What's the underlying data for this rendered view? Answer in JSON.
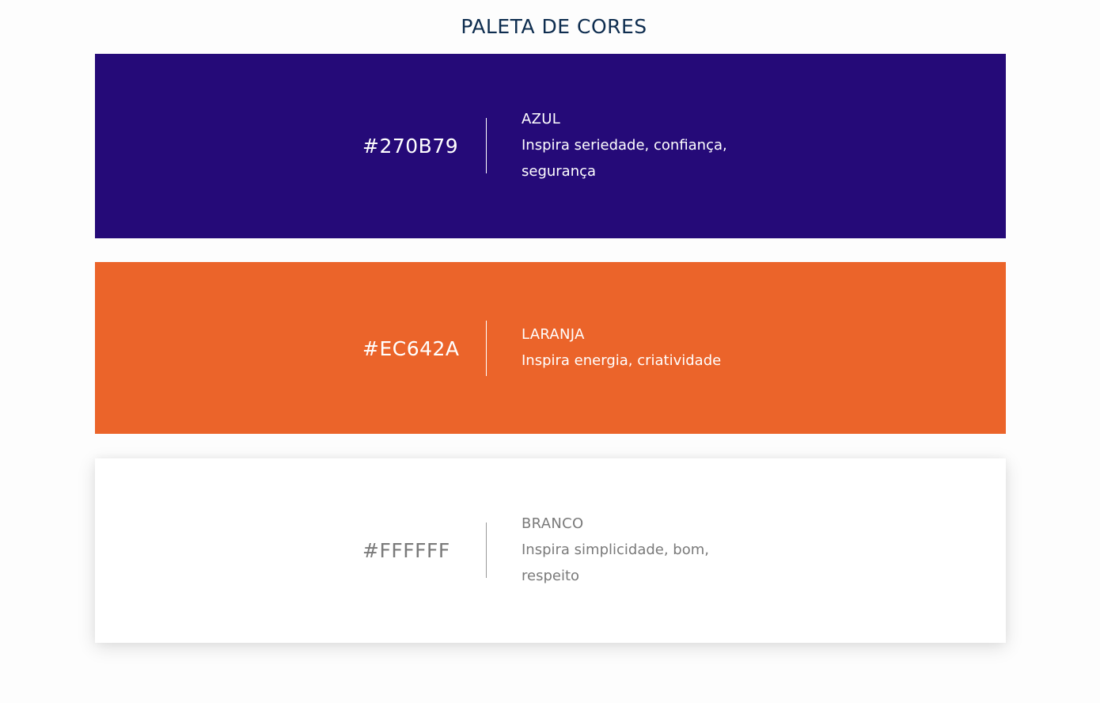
{
  "title": "PALETA DE CORES",
  "colors": [
    {
      "hex": "#270B79",
      "swatch_color": "#250a78",
      "text_color": "#ffffff",
      "divider_color": "#ffffff",
      "name": "AZUL",
      "description": "Inspira seriedade, confiança, segurança"
    },
    {
      "hex": "#EC642A",
      "swatch_color": "#eb642a",
      "text_color": "#ffffff",
      "divider_color": "#ffffff",
      "name": "LARANJA",
      "description": "Inspira energia, criatividade"
    },
    {
      "hex": "#FFFFFF",
      "swatch_color": "#ffffff",
      "text_color": "#7a7a7a",
      "divider_color": "#9a9a9a",
      "name": "BRANCO",
      "description": "Inspira simplicidade, bom, respeito"
    }
  ]
}
